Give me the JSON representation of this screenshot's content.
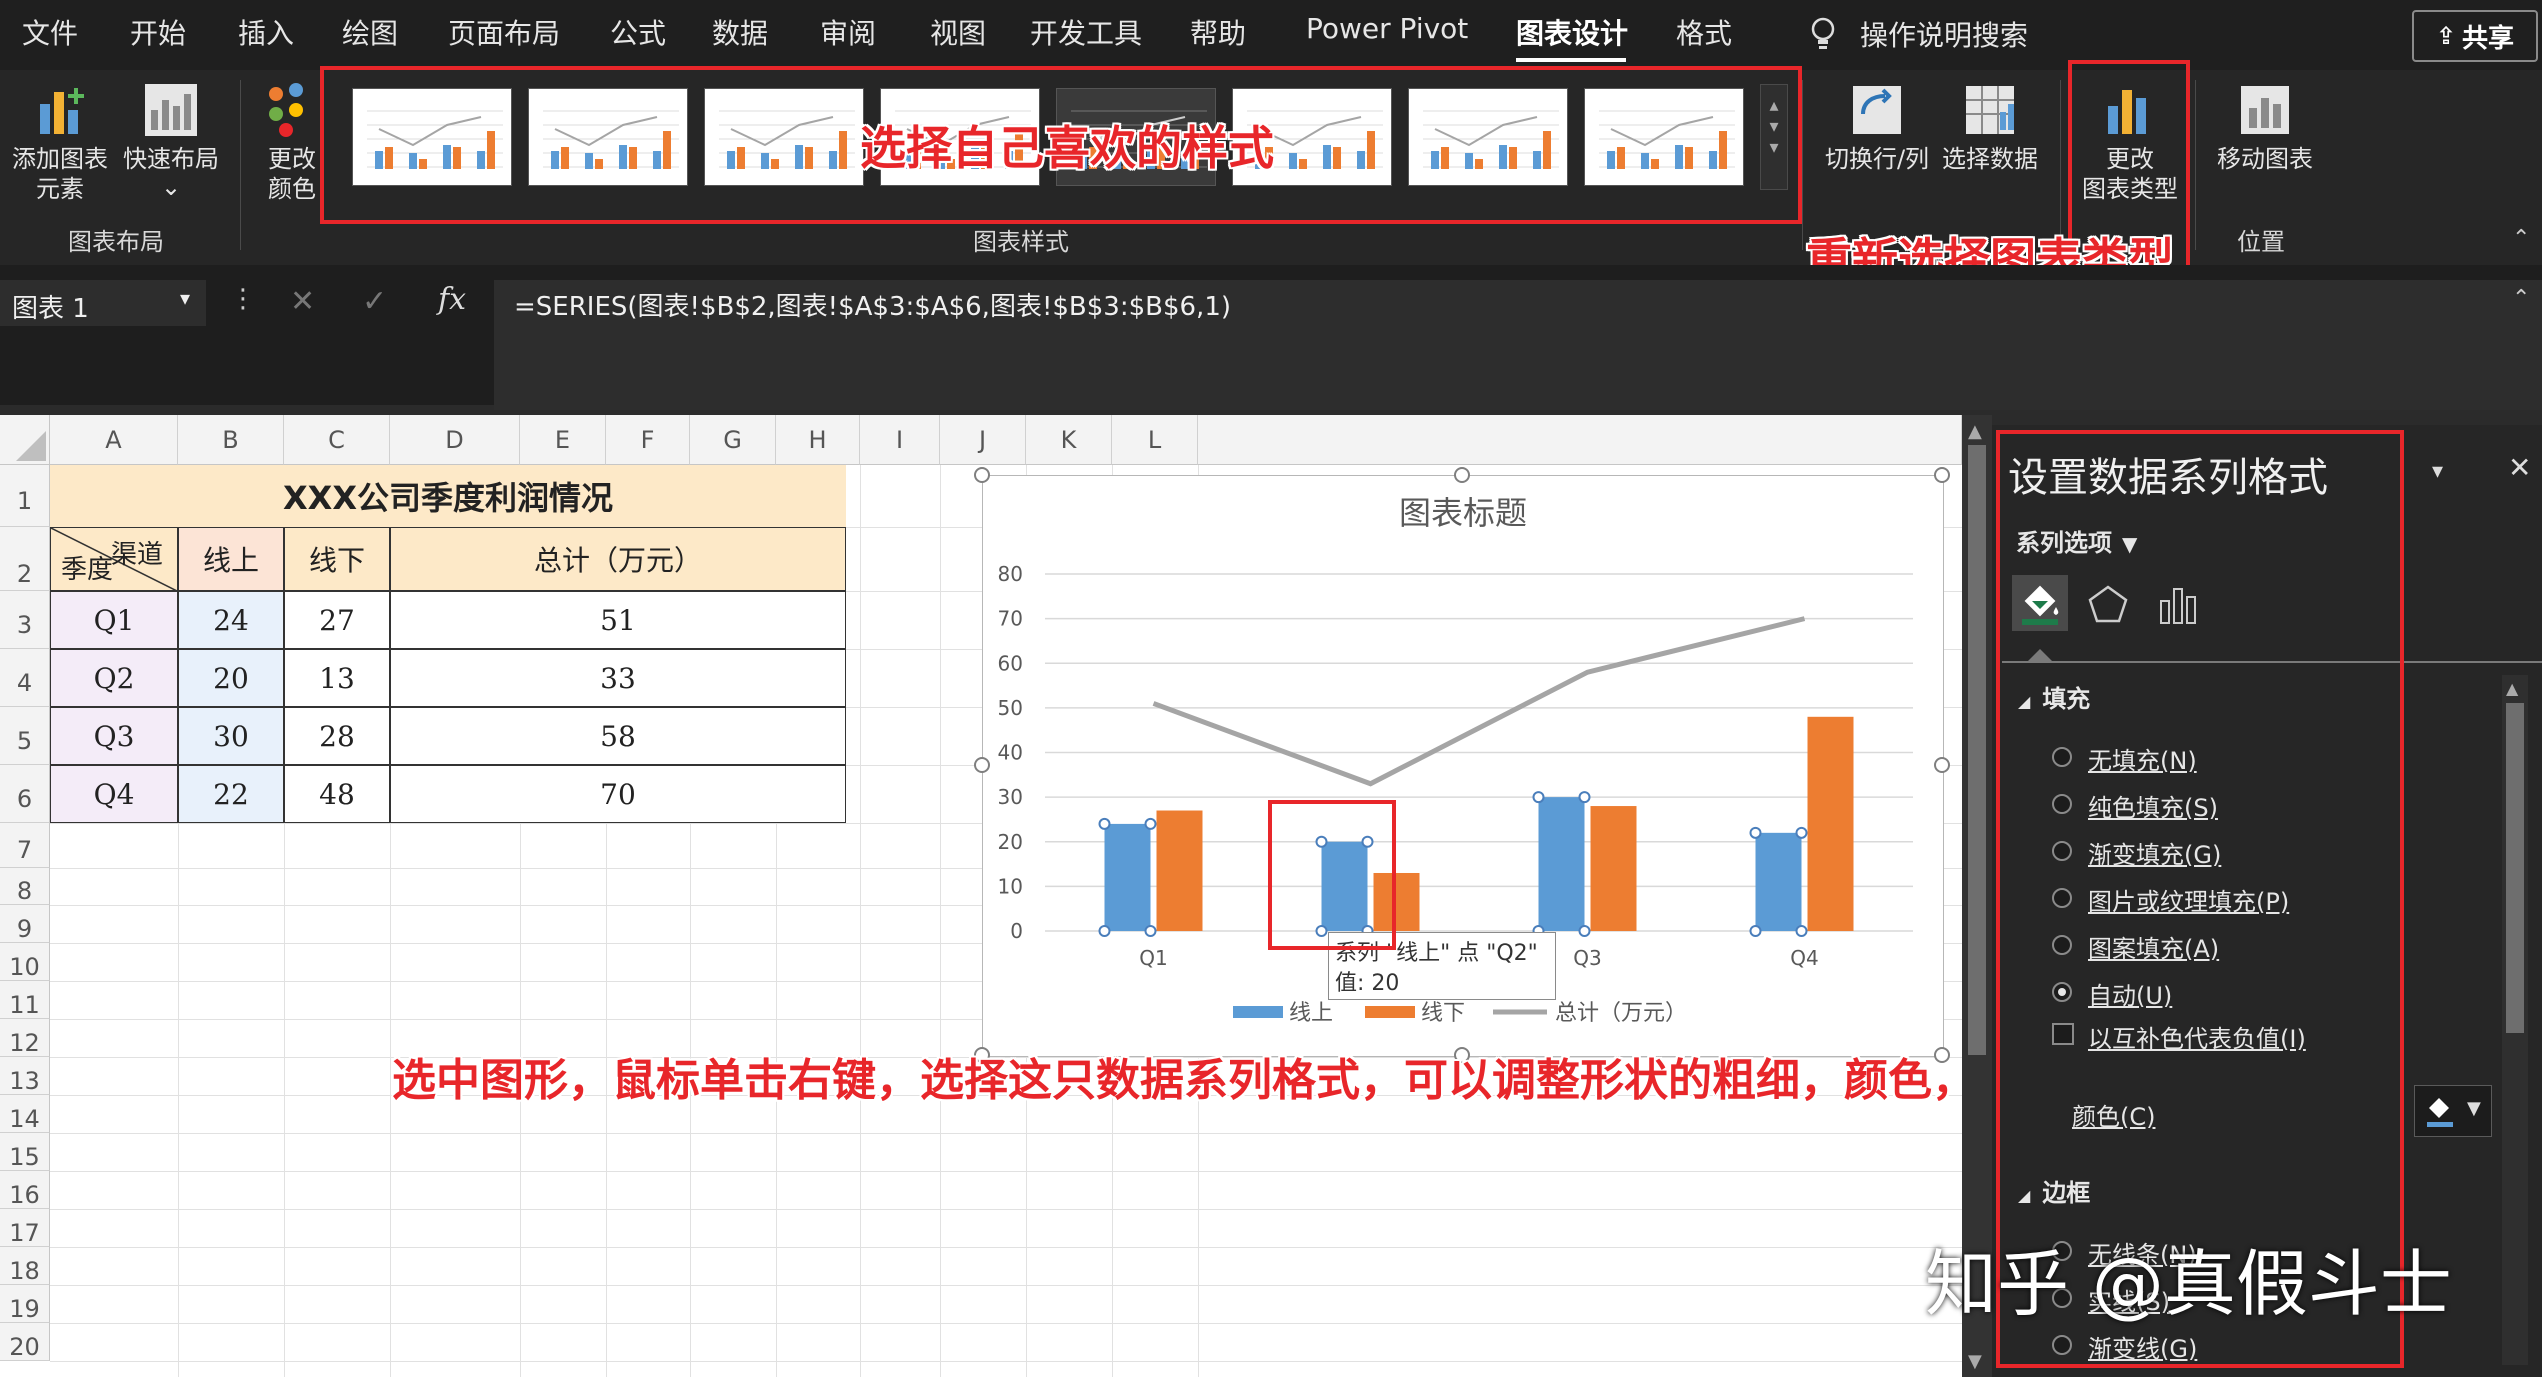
{
  "menu": {
    "items": [
      "文件",
      "开始",
      "插入",
      "绘图",
      "页面布局",
      "公式",
      "数据",
      "审阅",
      "视图",
      "开发工具",
      "帮助",
      "Power Pivot",
      "图表设计",
      "格式"
    ],
    "active": "图表设计",
    "search": "操作说明搜索",
    "share": "共享"
  },
  "ribbon": {
    "add_element": "添加图表\n元素",
    "quick_layout": "快速布局",
    "change_colors": "更改\n颜色",
    "group_layout": "图表布局",
    "group_styles": "图表样式",
    "switch_rowcol": "切换行/列",
    "select_data": "选择数据",
    "change_type": "更改\n图表类型",
    "move_chart": "移动图表",
    "group_location": "位置"
  },
  "annotations": {
    "styles": "选择自己喜欢的样式",
    "type": "重新选择图表类型",
    "format": "选中图形，鼠标单击右键，选择这只数据系列格式，可以调整形状的粗细，颜色，间隔距离等"
  },
  "formula": {
    "namebox": "图表 1",
    "fx": "fx",
    "value": "=SERIES(图表!$B$2,图表!$A$3:$A$6,图表!$B$3:$B$6,1)"
  },
  "sheet": {
    "columns": [
      "A",
      "B",
      "C",
      "D",
      "E",
      "F",
      "G",
      "H",
      "I",
      "J",
      "K",
      "L"
    ],
    "rows": [
      "1",
      "2",
      "3",
      "4",
      "5",
      "6",
      "7",
      "8",
      "9",
      "10",
      "11",
      "12",
      "13",
      "14",
      "15",
      "16",
      "17",
      "18",
      "19",
      "20"
    ],
    "title": "XXX公司季度利润情况",
    "corner_top": "渠道",
    "corner_bottom": "季度",
    "headers": [
      "线上",
      "线下",
      "总计（万元）"
    ],
    "data": [
      [
        "Q1",
        "24",
        "27",
        "51"
      ],
      [
        "Q2",
        "20",
        "13",
        "33"
      ],
      [
        "Q3",
        "30",
        "28",
        "58"
      ],
      [
        "Q4",
        "22",
        "48",
        "70"
      ]
    ]
  },
  "chart_data": {
    "type": "bar",
    "title": "图表标题",
    "categories": [
      "Q1",
      "Q2",
      "Q3",
      "Q4"
    ],
    "series": [
      {
        "name": "线上",
        "type": "bar",
        "color": "#5b9bd5",
        "values": [
          24,
          20,
          30,
          22
        ]
      },
      {
        "name": "线下",
        "type": "bar",
        "color": "#ed7d31",
        "values": [
          27,
          13,
          28,
          48
        ]
      },
      {
        "name": "总计（万元）",
        "type": "line",
        "color": "#a5a5a5",
        "values": [
          51,
          33,
          58,
          70
        ]
      }
    ],
    "ylim": [
      0,
      80
    ],
    "yticks": [
      "0",
      "10",
      "20",
      "30",
      "40",
      "50",
      "60",
      "70",
      "80"
    ],
    "grid": true,
    "legend": "bottom",
    "tooltip_line1": "系列 \"线上\" 点 \"Q2\"",
    "tooltip_line2": "值: 20"
  },
  "pane": {
    "title": "设置数据系列格式",
    "series_options": "系列选项",
    "fill_header": "填充",
    "fill_options": [
      "无填充(N)",
      "纯色填充(S)",
      "渐变填充(G)",
      "图片或纹理填充(P)",
      "图案填充(A)",
      "自动(U)"
    ],
    "invert": "以互补色代表负值(I)",
    "color": "颜色(C)",
    "border_header": "边框",
    "border_options": [
      "无线条(N)",
      "实线(S)",
      "渐变线(G)"
    ],
    "selected_fill": "自动(U)"
  },
  "watermark": "知乎 @真假斗士",
  "colors": {
    "accent": "#e8262a",
    "bar1": "#5b9bd5",
    "bar2": "#ed7d31",
    "line": "#a5a5a5"
  }
}
